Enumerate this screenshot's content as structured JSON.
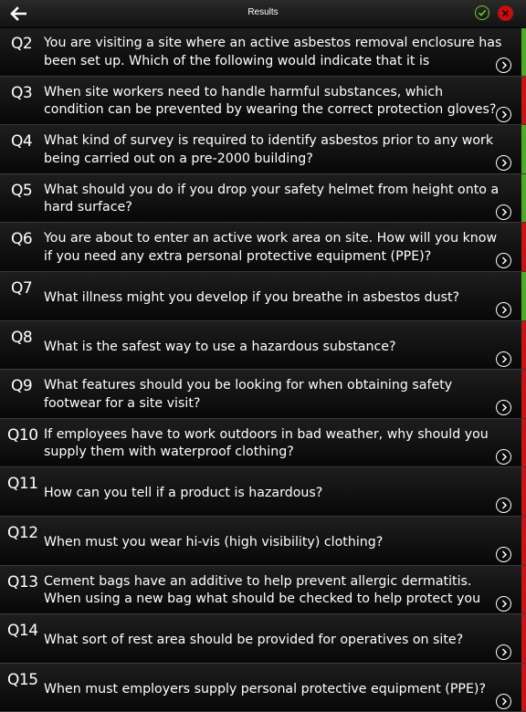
{
  "header": {
    "title": "Results"
  },
  "colors": {
    "correct": "#4faa2a",
    "incorrect": "#c01818"
  },
  "questions": [
    {
      "num": "Q2",
      "text": "You are visiting a site where an active asbestos removal enclosure has been set up. Which of the following would indicate that it is",
      "result": "correct"
    },
    {
      "num": "Q3",
      "text": "When site workers need to handle harmful substances, which condition can be prevented by wearing the correct protection gloves?",
      "result": "incorrect"
    },
    {
      "num": "Q4",
      "text": "What kind of survey is required to identify asbestos prior to any work being carried out on a pre-2000 building?",
      "result": "correct"
    },
    {
      "num": "Q5",
      "text": "What should you do if you drop your safety helmet from height onto a hard surface?",
      "result": "correct"
    },
    {
      "num": "Q6",
      "text": "You are about to enter an active work area on site. How will you know if you need any extra personal protective equipment (PPE)?",
      "result": "incorrect"
    },
    {
      "num": "Q7",
      "text": "What illness might you develop if you breathe in asbestos dust?",
      "result": "correct"
    },
    {
      "num": "Q8",
      "text": "What is the safest way to use a hazardous substance?",
      "result": "incorrect"
    },
    {
      "num": "Q9",
      "text": "What features should you be looking for when obtaining safety footwear for a site visit?",
      "result": "incorrect"
    },
    {
      "num": "Q10",
      "text": "If employees have to work outdoors in bad weather, why should you supply them with waterproof clothing?",
      "result": "incorrect"
    },
    {
      "num": "Q11",
      "text": "How can you tell if a product is hazardous?",
      "result": "incorrect"
    },
    {
      "num": "Q12",
      "text": "When must you wear hi-vis (high visibility) clothing?",
      "result": "incorrect"
    },
    {
      "num": "Q13",
      "text": "Cement bags have an additive to help prevent allergic dermatitis. When using a new bag what should be checked to help protect you",
      "result": "incorrect"
    },
    {
      "num": "Q14",
      "text": "What sort of rest area should be provided for operatives on site?",
      "result": "incorrect"
    },
    {
      "num": "Q15",
      "text": "When must employers supply personal protective equipment (PPE)?",
      "result": "incorrect"
    }
  ]
}
